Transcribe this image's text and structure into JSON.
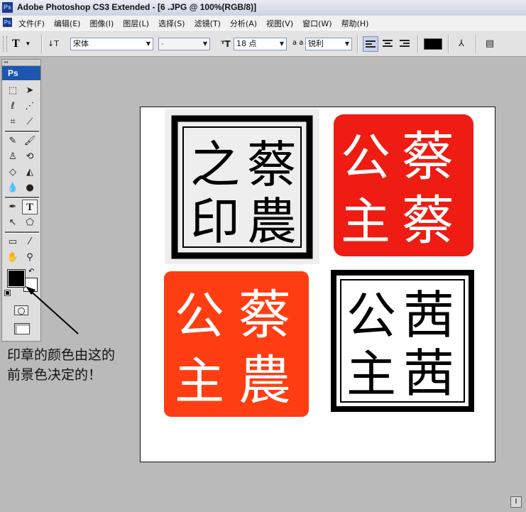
{
  "window": {
    "title": "Adobe Photoshop CS3 Extended - [6 .JPG @ 100%(RGB/8)]",
    "logo": "Ps"
  },
  "menu": {
    "items": [
      "文件(F)",
      "编辑(E)",
      "图像(I)",
      "图层(L)",
      "选择(S)",
      "滤镜(T)",
      "分析(A)",
      "视图(V)",
      "窗口(W)",
      "帮助(H)"
    ]
  },
  "options": {
    "tool_glyph": "T",
    "font_family": "宋体",
    "font_style": "-",
    "font_size": "18 点",
    "aa_label": "a a",
    "antialias": "锐利"
  },
  "toolbox": {
    "header": "Ps"
  },
  "colors": {
    "foreground": "#000000",
    "background": "#ffffff",
    "seal_red": "#ee1c12",
    "seal_orange": "#ff3d12"
  },
  "seals": {
    "top_left": [
      "蔡",
      "農",
      "之",
      "印"
    ],
    "top_right": [
      "蔡",
      "蔡",
      "公",
      "主"
    ],
    "bottom_left": [
      "蔡",
      "農",
      "公",
      "主"
    ],
    "bottom_right": [
      "茜",
      "茜",
      "公",
      "主"
    ]
  },
  "annotation": {
    "line1": "印章的颜色由这的",
    "line2": "前景色决定的！"
  }
}
